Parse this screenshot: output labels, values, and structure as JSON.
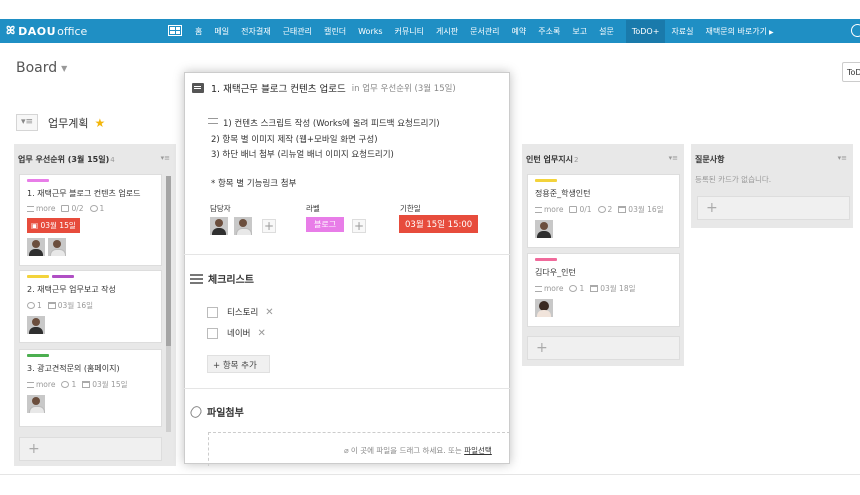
{
  "app": {
    "logo_text": "DAOU",
    "logo_sub": "office"
  },
  "nav": {
    "items": [
      "홈",
      "메일",
      "전자결재",
      "근태관리",
      "캘린더",
      "Works",
      "커뮤니티",
      "게시판",
      "문서관리",
      "예약",
      "주소록",
      "보고",
      "설문",
      "ToDO+",
      "자료실",
      "재택문의 바로가기"
    ],
    "active_index": 13
  },
  "board": {
    "title": "Board",
    "todo_button": "ToD"
  },
  "section": {
    "name": "업무계획"
  },
  "columns": [
    {
      "title": "업무 우선순위 (3월 15일)",
      "count": "4",
      "cards": [
        {
          "title": "1. 재택근무 블로그 컨텐츠 업로드",
          "more": "more",
          "check": "0/2",
          "comments": "1",
          "date": "03월 15일"
        },
        {
          "title": "2. 재택근무 업무보고 작성",
          "comments": "1",
          "date": "03월 16일"
        },
        {
          "title": "3. 광고견적문의 (홈페이지)",
          "more": "more",
          "comments": "1",
          "date": "03월 15일"
        }
      ]
    },
    {
      "title": "인턴 업무지시",
      "count": "2",
      "cards": [
        {
          "title": "정용준_학생인턴",
          "more": "more",
          "check": "0/1",
          "comments": "2",
          "date": "03월 16일"
        },
        {
          "title": "김다우_인턴",
          "more": "more",
          "comments": "1",
          "date": "03월 18일"
        }
      ]
    },
    {
      "title": "질문사항",
      "count": "",
      "empty": "등록된 카드가 없습니다."
    }
  ],
  "modal": {
    "title": "1. 재택근무 블로그 컨텐츠 업로드",
    "in_list": "in 업무 우선순위 (3월 15일)",
    "description": [
      "1) 컨텐츠 스크립트 작성 (Works에 올려 피드백 요청드리기)",
      "2) 항목 별 이미지 제작 (웹+모바일 화면 구성)",
      "3) 하단 배너 첨부 (리뉴얼 배너 이미지 요청드리기)",
      "",
      "* 항목 별 기능링크 첨부"
    ],
    "assignee_label": "담당자",
    "label_label": "라벨",
    "due_label": "기한일",
    "label_value": "블로그",
    "due_value": "03월 15일 15:00",
    "checklist_title": "체크리스트",
    "checklist_items": [
      "티스토리",
      "네이버"
    ],
    "add_item": "항목 추가",
    "attach_title": "파일첨부",
    "drop_text": "이 곳에 파일을 드래그 하세요. 또는",
    "drop_link": "파일선택"
  },
  "colors": {
    "nav_bg": "#1f8fc4",
    "date_badge": "#e74c3c",
    "label_pink": "#e87de8",
    "star": "#f3b60b"
  }
}
